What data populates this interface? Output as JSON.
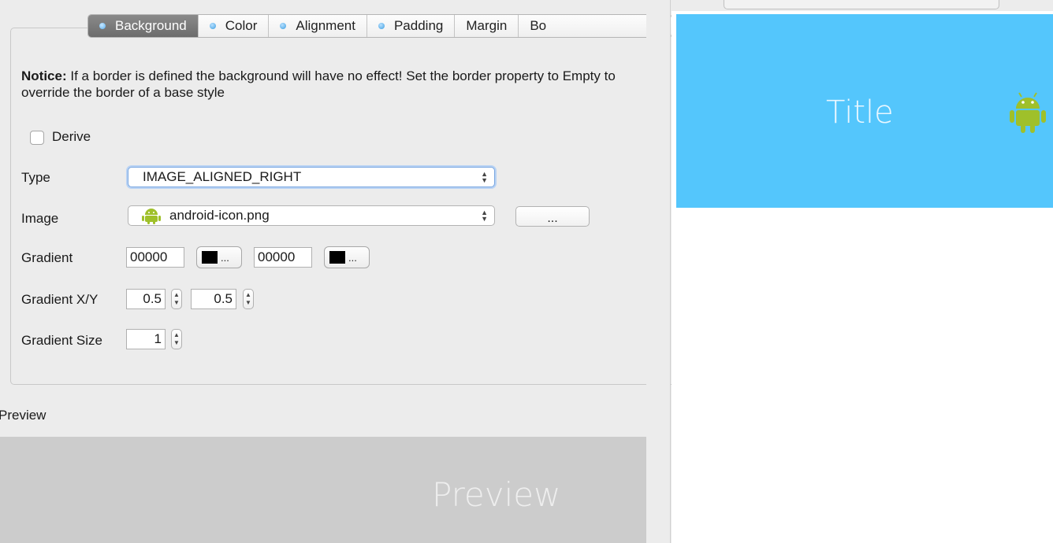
{
  "tabs": [
    {
      "label": "Background",
      "dot": true,
      "selected": true
    },
    {
      "label": "Color",
      "dot": true,
      "selected": false
    },
    {
      "label": "Alignment",
      "dot": true,
      "selected": false
    },
    {
      "label": "Padding",
      "dot": true,
      "selected": false
    },
    {
      "label": "Margin",
      "dot": false,
      "selected": false
    },
    {
      "label": "Bo",
      "dot": false,
      "selected": false
    }
  ],
  "notice": {
    "bold": "Notice:",
    "text": " If a border is defined the background will have no effect! Set the border property to Empty to override the border of a base style"
  },
  "derive": {
    "label": "Derive",
    "checked": false
  },
  "type": {
    "label": "Type",
    "value": "IMAGE_ALIGNED_RIGHT"
  },
  "image": {
    "label": "Image",
    "value": "android-icon.png",
    "browse_label": "..."
  },
  "gradient": {
    "label": "Gradient",
    "color1": "00000",
    "color2": "00000",
    "picker_label": "..."
  },
  "gradient_xy": {
    "label": "Gradient X/Y",
    "x": "0.5",
    "y": "0.5"
  },
  "gradient_size": {
    "label": "Gradient Size",
    "value": "1"
  },
  "preview": {
    "label": "Preview",
    "sample_text": "Preview"
  },
  "right_preview": {
    "title": "Title",
    "background": "#54c6fc",
    "icon": "android-icon"
  },
  "colors": {
    "accent": "#54c6fc",
    "android_green": "#9fc02a",
    "preview_bg": "#cccccc"
  }
}
